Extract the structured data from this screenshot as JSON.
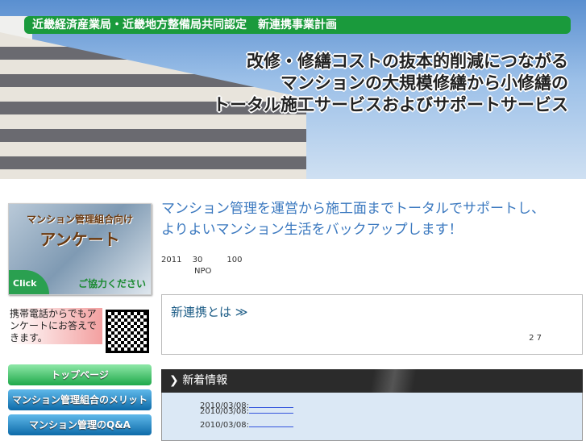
{
  "banner": {
    "topbar": "近畿経済産業局・近畿地方整備局共同認定　新連携事業計画",
    "lines": [
      "改修・修繕コストの抜本的削減につながる",
      "マンションの大規模修繕から小修繕の",
      "トータル施工サービスおよびサポートサービス"
    ]
  },
  "survey": {
    "line1": "マンション管理組合向け",
    "line2": "アンケート",
    "click": "Click",
    "line3": "ご協力ください"
  },
  "mobile": {
    "text": "携帯電話からでもアンケートにお答えできます。"
  },
  "nav": [
    {
      "label": "トップページ"
    },
    {
      "label": "マンション管理組合のメリット"
    },
    {
      "label": "マンション管理のQ&A"
    }
  ],
  "main": {
    "tagline1": "マンション管理を運営から施工面までトータルでサポートし、",
    "tagline2": "よりよいマンション生活をバックアップします！",
    "info1": "2011　 30　　　100",
    "info2": "NPO"
  },
  "renkei": {
    "heading": "新連携とは ≫",
    "number": "2 7"
  },
  "news": {
    "heading": "新着情報",
    "items": [
      {
        "date": "2010/03/08:"
      },
      {
        "date": "2010/03/08:"
      },
      {
        "date": "2010/03/08:"
      }
    ]
  }
}
